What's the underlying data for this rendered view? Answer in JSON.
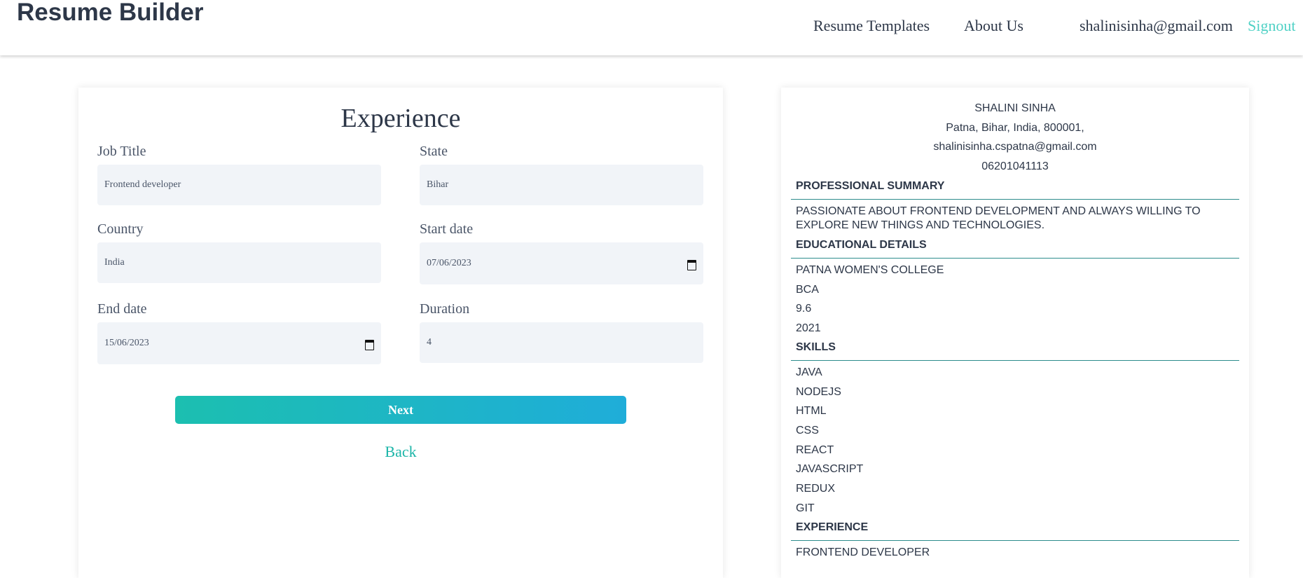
{
  "header": {
    "brand": "Resume Builder",
    "nav": {
      "templates": "Resume Templates",
      "about": "About Us",
      "email": "shalinisinha@gmail.com",
      "signout": "Signout"
    }
  },
  "form": {
    "title": "Experience",
    "fields": {
      "job_title": {
        "label": "Job Title",
        "value": "Frontend developer"
      },
      "state": {
        "label": "State",
        "value": "Bihar"
      },
      "country": {
        "label": "Country",
        "value": "India"
      },
      "start_date": {
        "label": "Start date",
        "value": "07/06/2023"
      },
      "end_date": {
        "label": "End date",
        "value": "15/06/2023"
      },
      "duration": {
        "label": "Duration",
        "value": "4"
      }
    },
    "next_label": "Next",
    "back_label": "Back"
  },
  "preview": {
    "name": "SHALINI SINHA",
    "address": "Patna, Bihar, India, 800001,",
    "email": "shalinisinha.cspatna@gmail.com",
    "phone": "06201041113",
    "sections": {
      "summary": {
        "heading": "PROFESSIONAL SUMMARY",
        "text": "PASSIONATE ABOUT FRONTEND DEVELOPMENT AND ALWAYS WILLING TO EXPLORE NEW THINGS AND TECHNOLOGIES."
      },
      "education": {
        "heading": "EDUCATIONAL DETAILS",
        "items": [
          "PATNA WOMEN'S COLLEGE",
          "BCA",
          "9.6",
          "2021"
        ]
      },
      "skills": {
        "heading": "SKILLS",
        "items": [
          "JAVA",
          "NODEJS",
          "HTML",
          "CSS",
          "REACT",
          "JAVASCRIPT",
          "REDUX",
          "GIT"
        ]
      },
      "experience": {
        "heading": "EXPERIENCE",
        "items": [
          "FRONTEND DEVELOPER"
        ]
      }
    }
  },
  "colors": {
    "accent": "#4fd1c5",
    "rule": "#2c8c8c",
    "button_start": "#1cbfb0",
    "button_end": "#1fadd9",
    "field_bg": "#f1f4f8"
  }
}
